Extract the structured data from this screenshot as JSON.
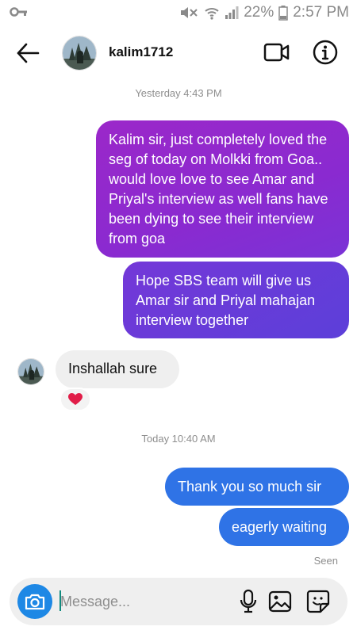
{
  "status_bar": {
    "battery": "22%",
    "time": "2:57 PM",
    "icons": [
      "key-icon",
      "mute-icon",
      "wifi-icon",
      "signal-icon",
      "battery-icon"
    ]
  },
  "header": {
    "username": "kalim1712",
    "icons": [
      "back-arrow-icon",
      "video-call-icon",
      "info-icon"
    ]
  },
  "conversation": {
    "timestamp_1": "Yesterday 4:43 PM",
    "sent_1": "Kalim sir, just completely loved the seg of today on Molkki from Goa.. would love love to see Amar and Priyal's interview as well fans have been dying to see their interview from goa",
    "sent_2": "Hope SBS team will give us Amar sir and Priyal mahajan interview together",
    "received_1": "Inshallah sure",
    "reaction_icon": "heart-icon",
    "timestamp_2": "Today 10:40 AM",
    "sent_3": "Thank you so much sir",
    "sent_4": "eagerly waiting",
    "seen_label": "Seen"
  },
  "composer": {
    "placeholder": "Message...",
    "value": "",
    "icons": [
      "camera-icon",
      "microphone-icon",
      "gallery-icon",
      "sticker-icon"
    ]
  },
  "colors": {
    "gradient_purple": "#9b28c9",
    "gradient_violet": "#5c3fd9",
    "sent_blue": "#2f73e6",
    "camera_blue": "#1e88e5",
    "received_gray": "#efefef"
  }
}
